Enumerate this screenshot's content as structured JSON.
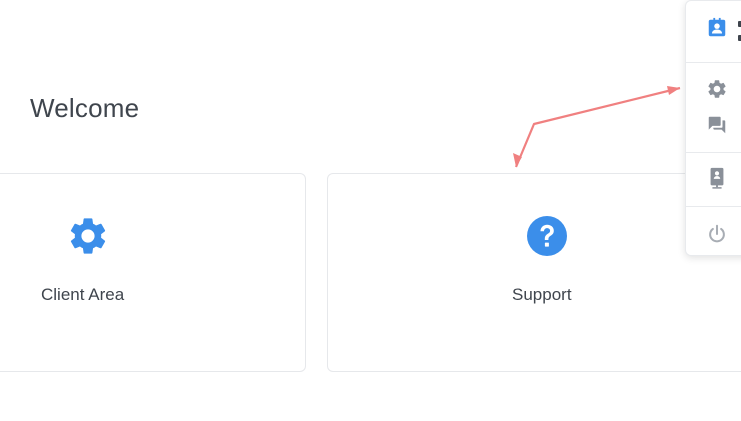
{
  "main": {
    "heading": "Welcome",
    "cards": [
      {
        "label": "Client Area",
        "icon": "gear-icon"
      },
      {
        "label": "Support",
        "icon": "question-circle-icon"
      }
    ]
  },
  "dropdown": {
    "items": [
      {
        "icon": "contact-card-icon"
      },
      {
        "icon": "gear-icon"
      },
      {
        "icon": "chat-icon"
      },
      {
        "icon": "id-badge-icon"
      },
      {
        "icon": "power-icon"
      }
    ]
  },
  "colors": {
    "accent": "#3b8eea",
    "text": "#3f454d",
    "icon_gray": "#8a9099",
    "border": "#e6e8eb",
    "annotation_arrow": "#f08080"
  }
}
